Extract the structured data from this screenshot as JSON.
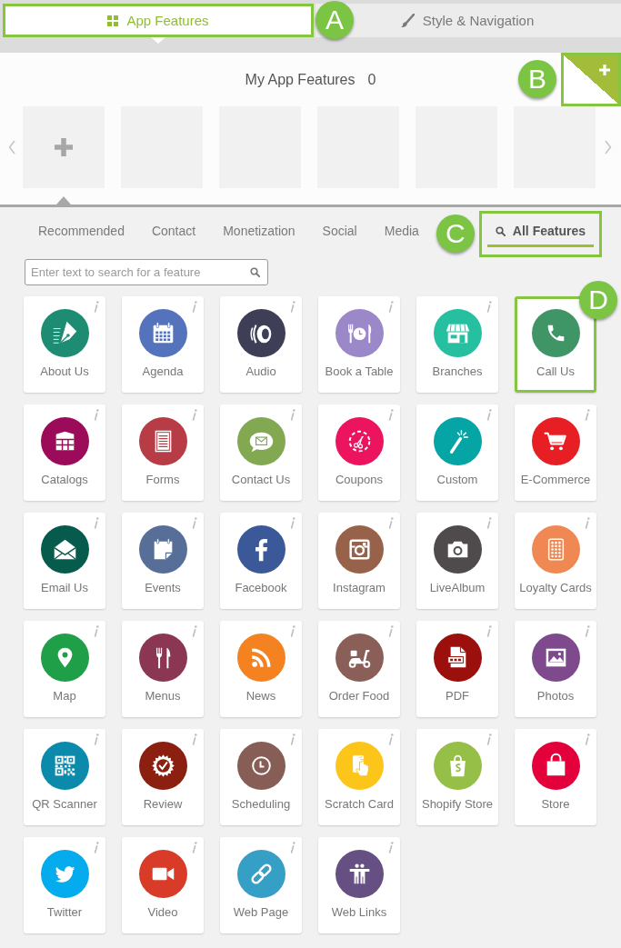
{
  "top_tabs": [
    {
      "label": "App Features",
      "kind": "grid",
      "selected": true,
      "callout": "A"
    },
    {
      "label": "Style & Navigation",
      "kind": "brush",
      "selected": false
    }
  ],
  "my_features": {
    "title": "My App Features",
    "count": "0",
    "add_corner": {
      "callout": "B"
    },
    "slots": [
      {
        "kind": "add",
        "selected": true
      },
      {
        "kind": "empty",
        "selected": false
      },
      {
        "kind": "empty",
        "selected": false
      },
      {
        "kind": "empty",
        "selected": false
      },
      {
        "kind": "empty",
        "selected": false
      },
      {
        "kind": "empty",
        "selected": false
      }
    ]
  },
  "categories": [
    {
      "label": "Recommended",
      "kind": "text",
      "selected": false
    },
    {
      "label": "Contact",
      "kind": "text",
      "selected": false
    },
    {
      "label": "Monetization",
      "kind": "text",
      "selected": false
    },
    {
      "label": "Social",
      "kind": "text",
      "selected": false
    },
    {
      "label": "Media",
      "kind": "text",
      "selected": false
    },
    {
      "label": "All Features",
      "kind": "search",
      "selected": true,
      "callout": "C"
    }
  ],
  "search": {
    "placeholder": "Enter text to search for a feature"
  },
  "features": [
    {
      "label": "About Us",
      "kind": "pen",
      "color": "#1e8c73"
    },
    {
      "label": "Agenda",
      "kind": "calendar",
      "color": "#5572bd"
    },
    {
      "label": "Audio",
      "kind": "speaker",
      "color": "#3e3e56"
    },
    {
      "label": "Book a Table",
      "kind": "dining",
      "color": "#9a88c8"
    },
    {
      "label": "Branches",
      "kind": "storefront",
      "color": "#26c0a0"
    },
    {
      "label": "Call Us",
      "kind": "phone",
      "color": "#3f9566",
      "callout": "D"
    },
    {
      "label": "Catalogs",
      "kind": "catalog",
      "color": "#9c0b5a"
    },
    {
      "label": "Forms",
      "kind": "form",
      "color": "#b83c45"
    },
    {
      "label": "Contact Us",
      "kind": "chat",
      "color": "#82a852"
    },
    {
      "label": "Coupons",
      "kind": "coupon",
      "color": "#ec145f"
    },
    {
      "label": "Custom",
      "kind": "wand",
      "color": "#05a4a5"
    },
    {
      "label": "E-Commerce",
      "kind": "cart",
      "color": "#e81e25"
    },
    {
      "label": "Email Us",
      "kind": "envelope",
      "color": "#075b4d"
    },
    {
      "label": "Events",
      "kind": "note",
      "color": "#576f98"
    },
    {
      "label": "Facebook",
      "kind": "facebook",
      "color": "#3b5999"
    },
    {
      "label": "Instagram",
      "kind": "instagram",
      "color": "#976249"
    },
    {
      "label": "LiveAlbum",
      "kind": "camera",
      "color": "#4f4b4d"
    },
    {
      "label": "Loyalty Cards",
      "kind": "grid",
      "color": "#f08853"
    },
    {
      "label": "Map",
      "kind": "pin",
      "color": "#1f9f48"
    },
    {
      "label": "Menus",
      "kind": "cutlery",
      "color": "#8b3652"
    },
    {
      "label": "News",
      "kind": "rss",
      "color": "#f58220"
    },
    {
      "label": "Order Food",
      "kind": "scooter",
      "color": "#8a5f57"
    },
    {
      "label": "PDF",
      "kind": "pdf",
      "color": "#9b100c"
    },
    {
      "label": "Photos",
      "kind": "picture",
      "color": "#7f4a8d"
    },
    {
      "label": "QR Scanner",
      "kind": "qr",
      "color": "#0b8aac"
    },
    {
      "label": "Review",
      "kind": "seal",
      "color": "#8b1f10"
    },
    {
      "label": "Scheduling",
      "kind": "clock",
      "color": "#865e55"
    },
    {
      "label": "Scratch Card",
      "kind": "scratch",
      "color": "#fcc51a"
    },
    {
      "label": "Shopify Store",
      "kind": "shopify",
      "color": "#96bf48"
    },
    {
      "label": "Store",
      "kind": "bag",
      "color": "#e4003a"
    },
    {
      "label": "Twitter",
      "kind": "bird",
      "color": "#04acee"
    },
    {
      "label": "Video",
      "kind": "videocam",
      "color": "#d83b27"
    },
    {
      "label": "Web Page",
      "kind": "link",
      "color": "#369fc6"
    },
    {
      "label": "Web Links",
      "kind": "people",
      "color": "#664f83"
    }
  ]
}
